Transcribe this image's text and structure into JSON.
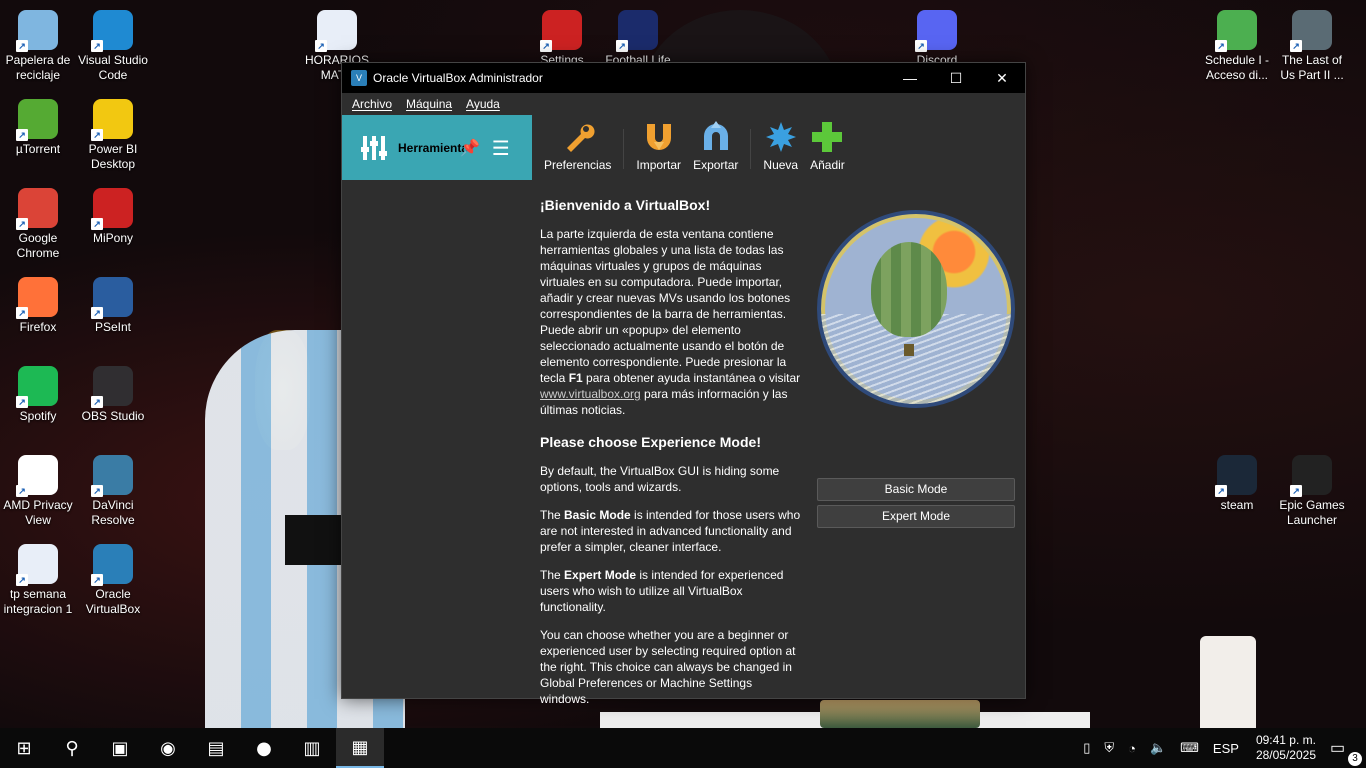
{
  "desktop": {
    "icons": [
      {
        "label": "Papelera de reciclaje",
        "icon": "recycle-bin-icon",
        "color": "#7fb6e0"
      },
      {
        "label": "Visual Studio Code",
        "icon": "vscode-icon",
        "color": "#1f8ad2"
      },
      {
        "label": "µTorrent",
        "icon": "utorrent-icon",
        "color": "#55aa33"
      },
      {
        "label": "Power BI Desktop",
        "icon": "powerbi-icon",
        "color": "#f2c811"
      },
      {
        "label": "Google Chrome",
        "icon": "chrome-icon",
        "color": "#db4437"
      },
      {
        "label": "MiPony",
        "icon": "mipony-icon",
        "color": "#cc2222"
      },
      {
        "label": "Firefox",
        "icon": "firefox-icon",
        "color": "#ff7139"
      },
      {
        "label": "PSeInt",
        "icon": "pseint-icon",
        "color": "#2a5d9f"
      },
      {
        "label": "Spotify",
        "icon": "spotify-icon",
        "color": "#1db954"
      },
      {
        "label": "OBS Studio",
        "icon": "obs-icon",
        "color": "#302e31"
      },
      {
        "label": "AMD Privacy View",
        "icon": "amd-privacy-icon",
        "color": "#ffffff"
      },
      {
        "label": "DaVinci Resolve",
        "icon": "davinci-icon",
        "color": "#3a7ca5"
      },
      {
        "label": "tp semana integracion 1",
        "icon": "document-icon",
        "color": "#e8eef8"
      },
      {
        "label": "Oracle VirtualBox",
        "icon": "virtualbox-icon",
        "color": "#2a7fb8"
      },
      {
        "label": "HORARIOS MATE",
        "icon": "document-icon",
        "color": "#e8eef8"
      },
      {
        "label": "Settings",
        "icon": "settings-icon",
        "color": "#cc2222"
      },
      {
        "label": "Football Life",
        "icon": "football-life-icon",
        "color": "#1b2b6b"
      },
      {
        "label": "Discord",
        "icon": "discord-icon",
        "color": "#5865f2"
      },
      {
        "label": "Schedule I - Acceso di...",
        "icon": "schedule-icon",
        "color": "#4caf50"
      },
      {
        "label": "The Last of Us Part II ...",
        "icon": "tlou-icon",
        "color": "#5a6b74"
      },
      {
        "label": "steam",
        "icon": "steam-icon",
        "color": "#1b2838"
      },
      {
        "label": "Epic Games Launcher",
        "icon": "epic-icon",
        "color": "#222222"
      }
    ]
  },
  "window": {
    "title": "Oracle VirtualBox Administrador",
    "controls": {
      "minimize": "—",
      "maximize": "☐",
      "close": "✕"
    },
    "menu": [
      "Archivo",
      "Máquina",
      "Ayuda"
    ],
    "tools_item": {
      "label": "Herramientas"
    },
    "toolbar": [
      {
        "label": "Preferencias",
        "icon": "wrench-icon",
        "color": "#f0a030"
      },
      {
        "label": "Importar",
        "icon": "import-icon",
        "color": "#f0a030"
      },
      {
        "label": "Exportar",
        "icon": "export-icon",
        "color": "#6ab0e8"
      },
      {
        "label": "Nueva",
        "icon": "new-vm-icon",
        "color": "#3aa0e0"
      },
      {
        "label": "Añadir",
        "icon": "add-icon",
        "color": "#5cc83a"
      }
    ],
    "welcome": {
      "heading": "¡Bienvenido a VirtualBox!",
      "p1_a": "La parte izquierda de esta ventana contiene herramientas globales y una lista de todas las máquinas virtuales y grupos de máquinas virtuales en su computadora. Puede importar, añadir y crear nuevas MVs usando los botones correspondientes de la barra de herramientas. Puede abrir un «popup» del elemento seleccionado actualmente usando el botón de elemento correspondiente. Puede presionar la tecla ",
      "p1_key": "F1",
      "p1_b": " para obtener ayuda instantánea o visitar ",
      "p1_link": "www.virtualbox.org",
      "p1_c": " para más información y las últimas noticias.",
      "mode_heading": "Please choose Experience Mode!",
      "p2": "By default, the VirtualBox GUI is hiding some options, tools and wizards.",
      "p3_a": "The ",
      "p3_b": "Basic Mode",
      "p3_c": " is intended for those users who are not interested in advanced functionality and prefer a simpler, cleaner interface.",
      "p4_a": "The ",
      "p4_b": "Expert Mode",
      "p4_c": " is intended for experienced users who wish to utilize all VirtualBox functionality.",
      "p5": "You can choose whether you are a beginner or experienced user by selecting required option at the right. This choice can always be changed in Global Preferences or Machine Settings windows."
    },
    "buttons": {
      "basic": "Basic Mode",
      "expert": "Expert Mode"
    }
  },
  "taskbar": {
    "items": [
      {
        "name": "start-button",
        "icon": "windows-icon",
        "glyph": "⊞"
      },
      {
        "name": "search-button",
        "icon": "search-icon",
        "glyph": "⚲"
      },
      {
        "name": "task-view-button",
        "icon": "task-view-icon",
        "glyph": "▣"
      },
      {
        "name": "taskbar-app-1",
        "icon": "app-icon",
        "glyph": "◉"
      },
      {
        "name": "taskbar-explorer",
        "icon": "folder-icon",
        "glyph": "▤"
      },
      {
        "name": "taskbar-firefox",
        "icon": "firefox-icon",
        "glyph": "●"
      },
      {
        "name": "taskbar-document",
        "icon": "document-icon",
        "glyph": "▥"
      },
      {
        "name": "taskbar-virtualbox",
        "icon": "virtualbox-icon",
        "glyph": "▦"
      }
    ],
    "language": "ESP",
    "time": "09:41 p. m.",
    "date": "28/05/2025",
    "notifications_count": "3"
  }
}
